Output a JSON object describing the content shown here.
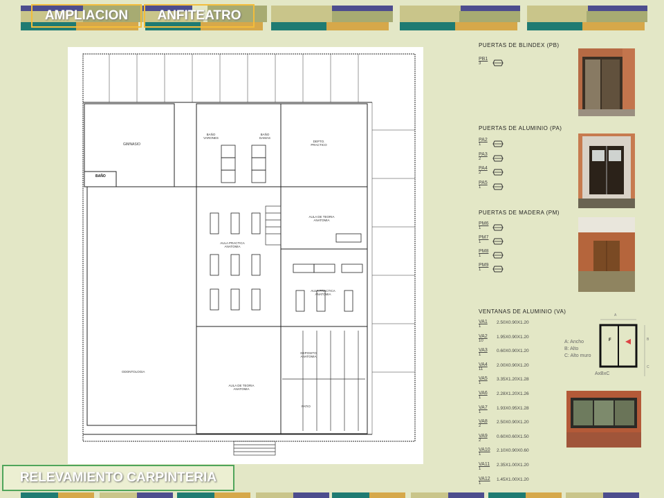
{
  "header": {
    "title_left": "AMPLIACION",
    "title_right": "ANFITEATRO"
  },
  "footer": {
    "title": "RELEVAMIENTO CARPINTERIA"
  },
  "colors": {
    "navy": "#4d4d8e",
    "teal": "#1f7b72",
    "olive": "#a7ab72",
    "khaki": "#c9c58a",
    "gold": "#d6a84a",
    "green_border": "#4fa55a",
    "gold_border": "#f3bd3b"
  },
  "plan": {
    "rooms": {
      "gimnasio": "GIMNASIO",
      "bano": "BAÑO",
      "bano_varones": "BAÑO VARONES",
      "bano_damas": "BAÑO DAMAS",
      "depto": "DEPTO. PRACTICO",
      "aula_teoria_1": "AULA DE TEORIA ANATOMIA",
      "aula_practica_1": "AULA PRACTICA ANATOMIA",
      "aula_practica_2": "AULA PRACTICA ANATOMIA",
      "odontologia": "ODONTOLOGIA",
      "aula_teoria_2": "AULA DE TEORIA ANATOMIA",
      "deposito": "DEPOSITO ANATOMIA",
      "patio": "PATIO"
    }
  },
  "sections": {
    "pb": {
      "title": "PUERTAS DE BLINDEX (PB)",
      "items": [
        {
          "code": "PB1",
          "qty": "3"
        }
      ]
    },
    "pa": {
      "title": "PUERTAS DE ALUMINIO (PA)",
      "items": [
        {
          "code": "PA2",
          "qty": "1"
        },
        {
          "code": "PA3",
          "qty": "2"
        },
        {
          "code": "PA4",
          "qty": "2"
        },
        {
          "code": "PA5",
          "qty": "1"
        }
      ]
    },
    "pm": {
      "title": "PUERTAS DE MADERA (PM)",
      "items": [
        {
          "code": "PM6",
          "qty": "1"
        },
        {
          "code": "PM7",
          "qty": "1"
        },
        {
          "code": "PM8",
          "qty": "1"
        },
        {
          "code": "PM9",
          "qty": "1"
        }
      ]
    },
    "va": {
      "title": "VENTANAS  DE ALUMINIO (VA)",
      "items": [
        {
          "code": "VA1",
          "qty": "1",
          "size": "2.50X0.90X1.20"
        },
        {
          "code": "VA2",
          "qty": "10",
          "size": "1.95X0.90X1.20"
        },
        {
          "code": "VA3",
          "qty": "1",
          "size": "0.60X0.90X1.20"
        },
        {
          "code": "VA4",
          "qty": "11",
          "size": "2.00X0.90X1.20"
        },
        {
          "code": "VA5",
          "qty": "1",
          "size": "3.35X1.20X1.28"
        },
        {
          "code": "VA6",
          "qty": "1",
          "size": "2.28X1.20X1.26"
        },
        {
          "code": "VA7",
          "qty": "1",
          "size": "1.93X0.95X1.28"
        },
        {
          "code": "VA8",
          "qty": "2",
          "size": "2.50X0.90X1.20"
        },
        {
          "code": "VA9",
          "qty": "2",
          "size": "0.60X0.60X1.50"
        },
        {
          "code": "VA10",
          "qty": "1",
          "size": "2.10X0.90X0.60"
        },
        {
          "code": "VA11",
          "qty": "1",
          "size": "2.35X1.00X1.20"
        },
        {
          "code": "VA12",
          "qty": "1",
          "size": "1.45X1.00X1.20"
        }
      ]
    }
  },
  "legend": {
    "a": "A: Ancho",
    "b": "B: Alto",
    "c": "C: Alto muro",
    "formula": "AxBxC",
    "dim_a": "A",
    "dim_b": "B",
    "dim_c": "C",
    "f": "F"
  }
}
